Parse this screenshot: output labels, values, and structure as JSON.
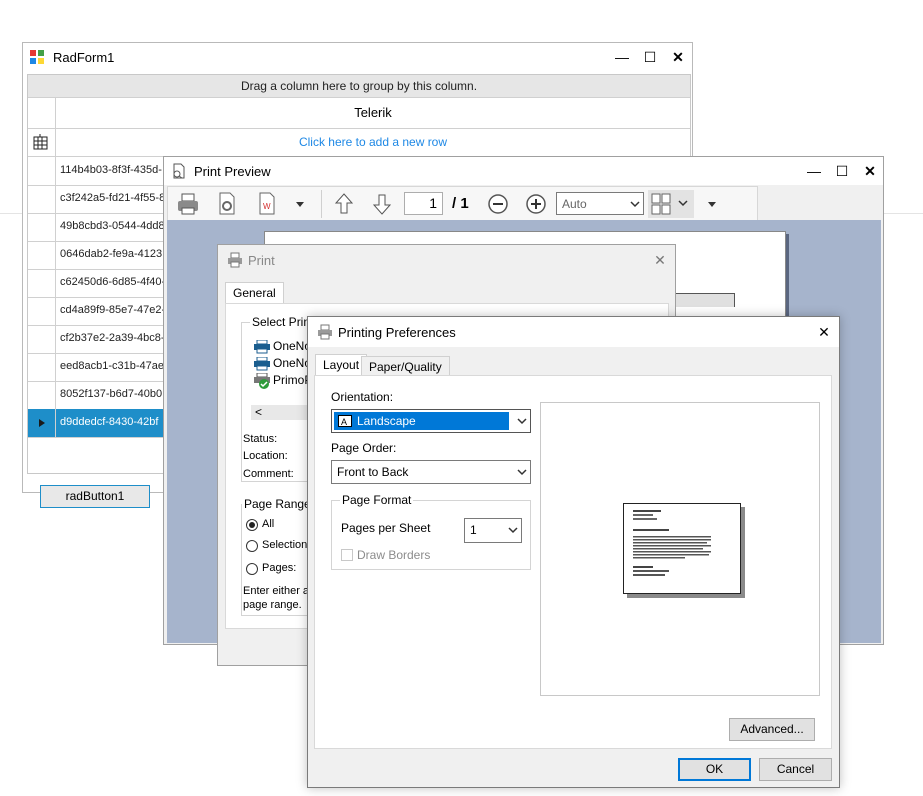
{
  "radform": {
    "title": "RadForm1",
    "group_panel_text": "Drag a column here to group by this column.",
    "column_header": "Telerik",
    "new_row_text": "Click here to add a new row",
    "rows": [
      "114b4b03-8f3f-435d-",
      "c3f242a5-fd21-4f55-8",
      "49b8cbd3-0544-4dd8",
      "0646dab2-fe9a-4123",
      "c62450d6-6d85-4f40-",
      "cd4a89f9-85e7-47e2-",
      "cf2b37e2-2a39-4bc8-",
      "eed8acb1-c31b-47ae",
      "8052f137-b6d7-40b0",
      "d9ddedcf-8430-42bf"
    ],
    "selected_row_index": 9,
    "button_label": "radButton1",
    "controls": {
      "minimize": "—",
      "maximize": "☐",
      "close": "✕"
    }
  },
  "preview": {
    "title": "Print Preview",
    "page_current": "1",
    "page_total": "/ 1",
    "zoom_value": "Auto",
    "controls": {
      "minimize": "—",
      "maximize": "☐",
      "close": "✕"
    }
  },
  "print_dialog": {
    "title": "Print",
    "tab": "General",
    "select_printer_label": "Select Printe",
    "printers": [
      "OneNo",
      "OneNo",
      "PrimoP"
    ],
    "scroll_left": "<",
    "status_label": "Status:",
    "location_label": "Location:",
    "comment_label": "Comment:",
    "page_range_label": "Page Range",
    "range_all": "All",
    "range_selection": "Selection",
    "range_pages": "Pages:",
    "hint_line1": "Enter either a",
    "hint_line2": "page range.",
    "close": "✕"
  },
  "prefs": {
    "title": "Printing Preferences",
    "tab_layout": "Layout",
    "tab_paper": "Paper/Quality",
    "orientation_label": "Orientation:",
    "orientation_value": "Landscape",
    "page_order_label": "Page Order:",
    "page_order_value": "Front to Back",
    "page_format_label": "Page Format",
    "pages_per_sheet_label": "Pages per Sheet",
    "pages_per_sheet_value": "1",
    "draw_borders_label": "Draw Borders",
    "advanced_button": "Advanced...",
    "ok_button": "OK",
    "cancel_button": "Cancel",
    "close": "✕"
  },
  "colors": {
    "selection_blue": "#1e8ec9",
    "link_blue": "#1e88e5",
    "preview_backdrop": "#a6b4cc",
    "focus_border": "#0078d7"
  }
}
